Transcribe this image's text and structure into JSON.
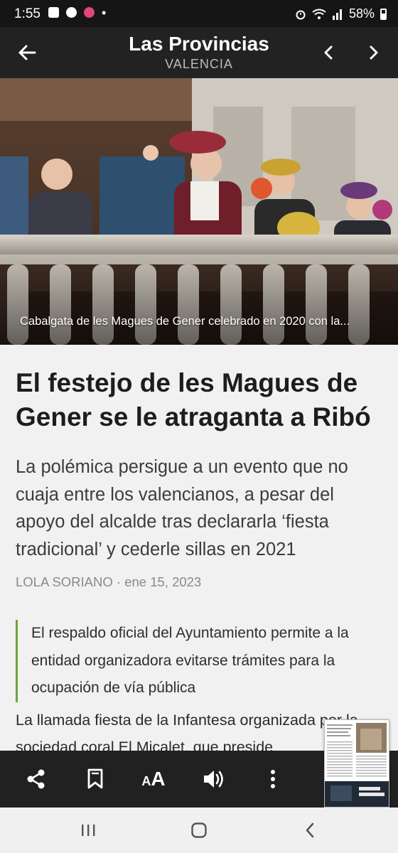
{
  "status_bar": {
    "time": "1:55",
    "battery": "58%",
    "left_icons": [
      "gallery-icon",
      "facebook-icon",
      "app-icon"
    ],
    "right_icons": [
      "alarm-icon",
      "wifi-icon",
      "signal-icon",
      "battery-icon"
    ]
  },
  "app_bar": {
    "title": "Las Provincias",
    "subtitle": "VALENCIA"
  },
  "article": {
    "image_caption": "Cabalgata de les Magues de Gener celebrado en 2020 con la...",
    "headline": "El festejo de les Magues de Gener se le atraganta a Ribó",
    "subheadline": "La polémica persigue a un evento que no cuaja entre los valencianos, a pesar del apoyo del alcalde tras declararla ‘fiesta tradicional’ y cederle sillas en 2021",
    "author": "LOLA SORIANO",
    "separator": " · ",
    "date": "ene 15, 2023",
    "pull_quote": "El respaldo oficial del Ayuntamiento permite a la entidad organizadora evitarse trámites para la ocupación de vía pública",
    "body_start": "La llamada fiesta de la Infantesa organizada por la sociedad coral El Micalet, que preside"
  },
  "toolbar": {
    "font_size_label": "AA",
    "icons": [
      "share-icon",
      "bookmark-icon",
      "font-size-icon",
      "volume-icon",
      "more-icon"
    ]
  },
  "colors": {
    "app_bar": "#222222",
    "quote_accent": "#6aa43a",
    "background": "#f1f1f1"
  }
}
